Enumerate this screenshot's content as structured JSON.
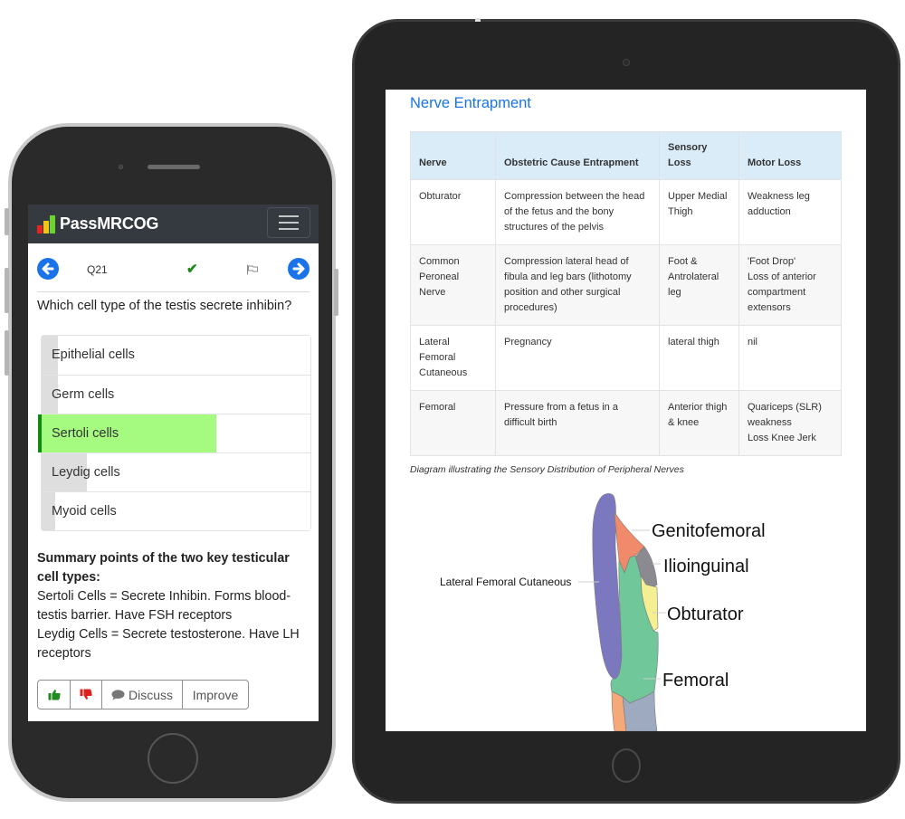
{
  "phone": {
    "app": {
      "brand": "PassMRCOG",
      "logo_colors": [
        "#e8231c",
        "#f0c419",
        "#6ad42b"
      ],
      "menu_icon": "hamburger-icon"
    },
    "question_bar": {
      "prev_icon": "arrow-left-circle-icon",
      "question_number": "Q21",
      "status_icon": "check-icon",
      "status_glyph": "✔",
      "flag_icon": "flag-icon",
      "next_icon": "arrow-right-circle-icon"
    },
    "question": "Which cell type of the testis secrete inhibin?",
    "options": [
      {
        "label": "Epithelial cells",
        "response_percent": 6,
        "correct": false
      },
      {
        "label": "Germ cells",
        "response_percent": 6,
        "correct": false
      },
      {
        "label": "Sertoli cells",
        "response_percent": 65,
        "correct": true
      },
      {
        "label": "Leydig cells",
        "response_percent": 17,
        "correct": false
      },
      {
        "label": "Myoid cells",
        "response_percent": 5,
        "correct": false
      }
    ],
    "summary": {
      "heading": "Summary points of the two key testicular cell types:",
      "line1": "Sertoli Cells = Secrete Inhibin. Forms blood-testis barrier. Have FSH receptors",
      "line2": "Leydig Cells = Secrete testosterone. Have LH receptors"
    },
    "actions": {
      "like_icon": "thumbs-up-icon",
      "dislike_icon": "thumbs-down-icon",
      "discuss_label": "Discuss",
      "improve_label": "Improve"
    },
    "colors": {
      "accent": "#1a73e8",
      "correct": "#a4fb80",
      "correct_border": "#0e8a0e",
      "navbar": "#343a40"
    }
  },
  "tablet": {
    "title": "Nerve Entrapment",
    "table": {
      "headers": [
        "Nerve",
        "Obstetric Cause Entrapment",
        "Sensory Loss",
        "Motor Loss"
      ],
      "rows": [
        [
          "Obturator",
          "Compression between the head of the fetus and the bony structures of the pelvis",
          "Upper Medial Thigh",
          "Weakness leg adduction"
        ],
        [
          "Common Peroneal Nerve",
          "Compression lateral head of fibula and leg bars (lithotomy position and other surgical procedures)",
          "Foot & Antrolateral leg",
          "'Foot Drop'\nLoss of anterior compartment extensors"
        ],
        [
          "Lateral Femoral Cutaneous",
          "Pregnancy",
          "lateral thigh",
          "nil"
        ],
        [
          "Femoral",
          "Pressure from a fetus in a difficult birth",
          "Anterior thigh & knee",
          "Quariceps (SLR) weakness\nLoss Knee Jerk"
        ]
      ]
    },
    "caption": "Diagram illustrating the Sensory Distribution of Peripheral Nerves",
    "diagram": {
      "labels": {
        "lateral_femoral_cutaneous": "Lateral Femoral Cutaneous",
        "genitofemoral": "Genitofemoral",
        "ilioinguinal": "Ilioinguinal",
        "obturator": "Obturator",
        "femoral": "Femoral"
      },
      "region_colors": {
        "lateral_femoral_cutaneous": "#7b78c0",
        "genitofemoral": "#f08a6a",
        "ilioinguinal": "#8a8a90",
        "obturator": "#f5ef93",
        "femoral": "#6fc79a",
        "lower_lateral": "#f5a878",
        "lower_medial": "#9eaac0"
      }
    }
  }
}
